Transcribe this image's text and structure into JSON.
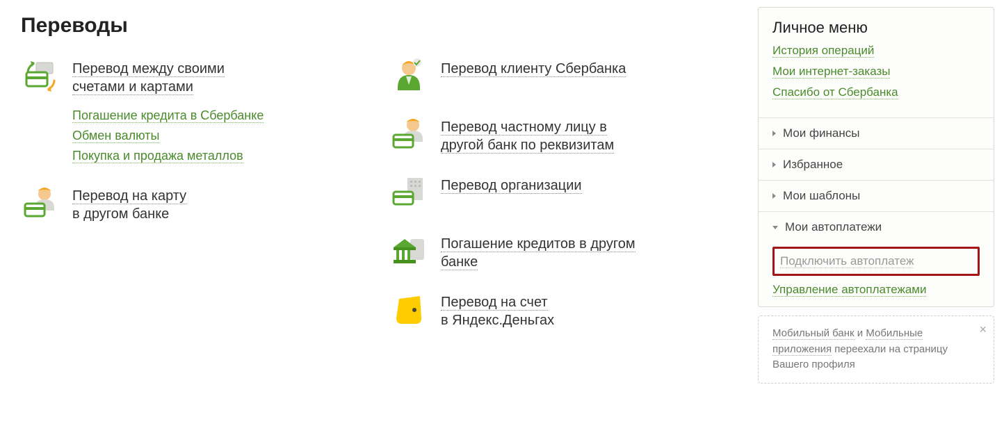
{
  "page": {
    "title": "Переводы"
  },
  "col_left": {
    "item1": {
      "line1": "Перевод между своими",
      "line2": "счетами и картами"
    },
    "sublinks": {
      "s1": "Погашение кредита в Сбербанке",
      "s2": "Обмен валюты",
      "s3": "Покупка и продажа металлов"
    },
    "item2": {
      "line1": "Перевод на карту",
      "line2": "в другом банке"
    }
  },
  "col_right": {
    "item1": {
      "line1": "Перевод клиенту Сбербанка"
    },
    "item2": {
      "line1": "Перевод частному лицу в",
      "line2": "другой банк по реквизитам"
    },
    "item3": {
      "line1": "Перевод организации"
    },
    "item4": {
      "line1": "Погашение кредитов в другом",
      "line2": "банке"
    },
    "item5": {
      "line1": "Перевод на счет",
      "line2": "в Яндекс.Деньгах"
    }
  },
  "sidebar": {
    "menu_title": "Личное меню",
    "links": {
      "l1": "История операций",
      "l2": "Мои интернет-заказы",
      "l3": "Спасибо от Сбербанка"
    },
    "acc": {
      "a1": "Мои финансы",
      "a2": "Избранное",
      "a3": "Мои шаблоны",
      "a4": "Мои автоплатежи"
    },
    "autopay": {
      "connect": "Подключить автоплатеж",
      "manage": "Управление автоплатежами"
    },
    "info": {
      "t1": "Мобильный банк",
      "t2": " и ",
      "t3": "Мобильные приложения",
      "t4": " переехали на страницу Вашего профиля"
    }
  }
}
